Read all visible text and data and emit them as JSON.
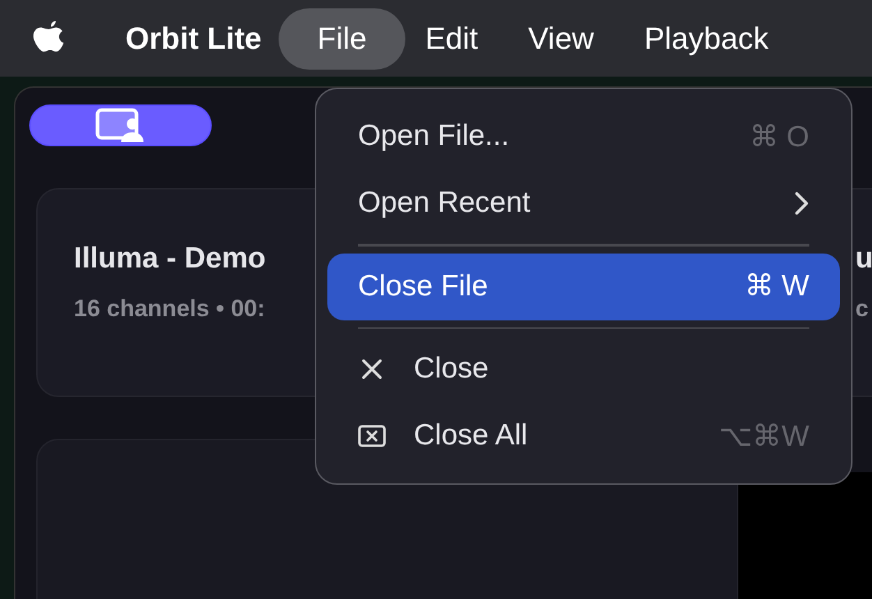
{
  "menubar": {
    "app_name": "Orbit Lite",
    "menus": [
      {
        "label": "File",
        "selected": true
      },
      {
        "label": "Edit",
        "selected": false
      },
      {
        "label": "View",
        "selected": false
      },
      {
        "label": "Playback",
        "selected": false
      }
    ]
  },
  "toolbar": {
    "view_toggle": {
      "selected": true
    }
  },
  "cards": [
    {
      "title": "Illuma - Demo",
      "subtitle": "16 channels • 00:"
    },
    {
      "title": "u",
      "subtitle": "c"
    }
  ],
  "file_menu": [
    {
      "kind": "item",
      "label": "Open File...",
      "shortcut": "⌘ O",
      "selected": false
    },
    {
      "kind": "submenu",
      "label": "Open Recent",
      "selected": false
    },
    {
      "kind": "separator"
    },
    {
      "kind": "item",
      "label": "Close File",
      "shortcut": "⌘ W",
      "selected": true
    },
    {
      "kind": "separator"
    },
    {
      "kind": "x_item",
      "label": "Close",
      "selected": false
    },
    {
      "kind": "boxed_x_item",
      "label": "Close All",
      "shortcut": "⌥⌘W",
      "selected": false
    }
  ]
}
